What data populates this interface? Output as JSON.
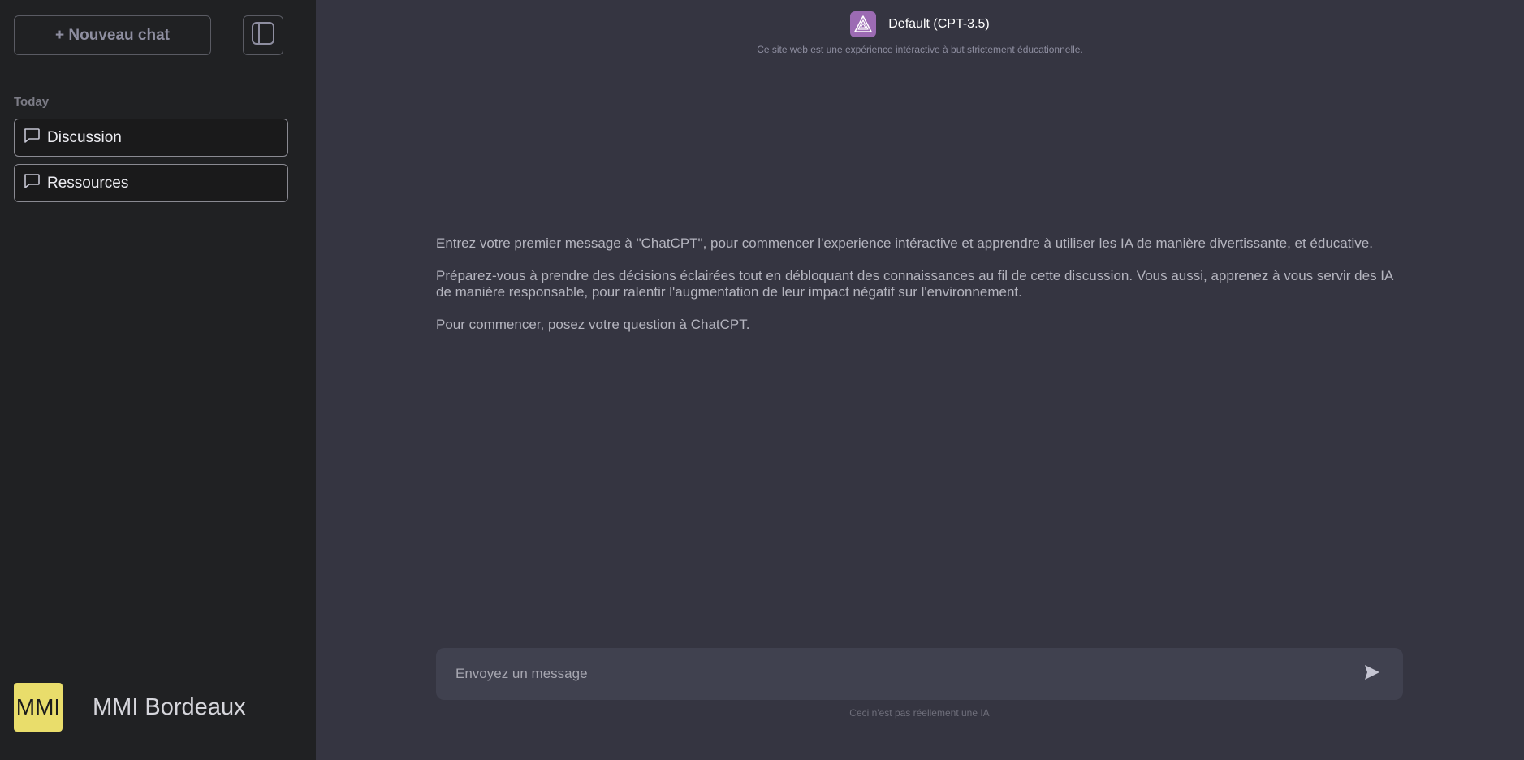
{
  "sidebar": {
    "new_chat_label": "+ Nouveau chat",
    "section_label": "Today",
    "items": [
      {
        "label": "Discussion",
        "icon": "chat-bubble-icon"
      },
      {
        "label": "Ressources",
        "icon": "chat-bubble-icon"
      }
    ],
    "user": {
      "avatar_text": "MMI",
      "avatar_color": "#e9dd6b",
      "name": "MMI Bordeaux"
    }
  },
  "header": {
    "model_name": "Default (CPT-3.5)",
    "disclaimer": "Ce site web est une expérience intéractive à but strictement éducationnelle."
  },
  "intro": {
    "paragraph1": "Entrez votre premier message à \"ChatCPT\", pour commencer l'experience intéractive et apprendre à utiliser les IA de manière divertissante, et éducative.",
    "paragraph2": "Préparez-vous à prendre des décisions éclairées tout en débloquant des connaissances au fil de cette discussion. Vous aussi, apprenez à vous servir des IA de manière responsable, pour ralentir l'augmentation de leur impact négatif sur l'environnement.",
    "paragraph3": "Pour commencer, posez votre question à ChatCPT."
  },
  "composer": {
    "placeholder": "Envoyez un message",
    "value": "",
    "footer": "Ceci n'est pas réellement une IA"
  },
  "colors": {
    "sidebar_bg": "#202123",
    "main_bg": "#353541",
    "input_bg": "#40414f",
    "logo_accent": "#9c6bb3"
  }
}
